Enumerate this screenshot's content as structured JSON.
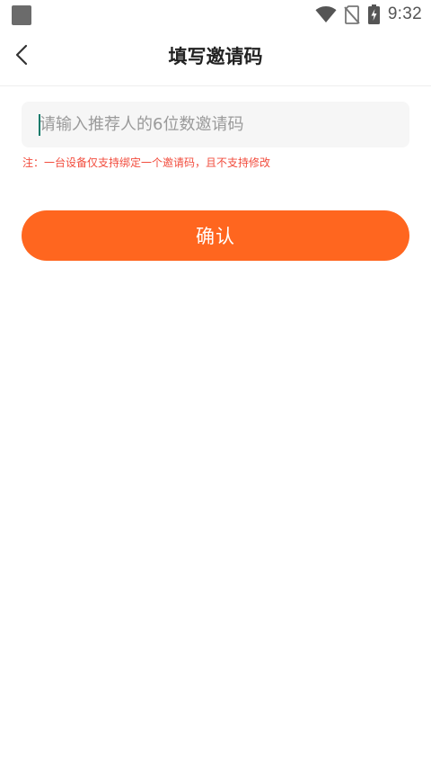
{
  "status_bar": {
    "time": "9:32",
    "icons": [
      "app-notification-icon",
      "wifi-icon",
      "no-sim-icon",
      "battery-charging-icon"
    ]
  },
  "header": {
    "back_icon": "chevron-left-icon",
    "title": "填写邀请码"
  },
  "form": {
    "code_input": {
      "placeholder": "请输入推荐人的6位数邀请码",
      "value": ""
    },
    "note": "注：一台设备仅支持绑定一个邀请码，且不支持修改",
    "confirm_label": "确认"
  },
  "colors": {
    "accent": "#ff661f",
    "note": "#f24c3d",
    "caret": "#0d7a6a"
  }
}
